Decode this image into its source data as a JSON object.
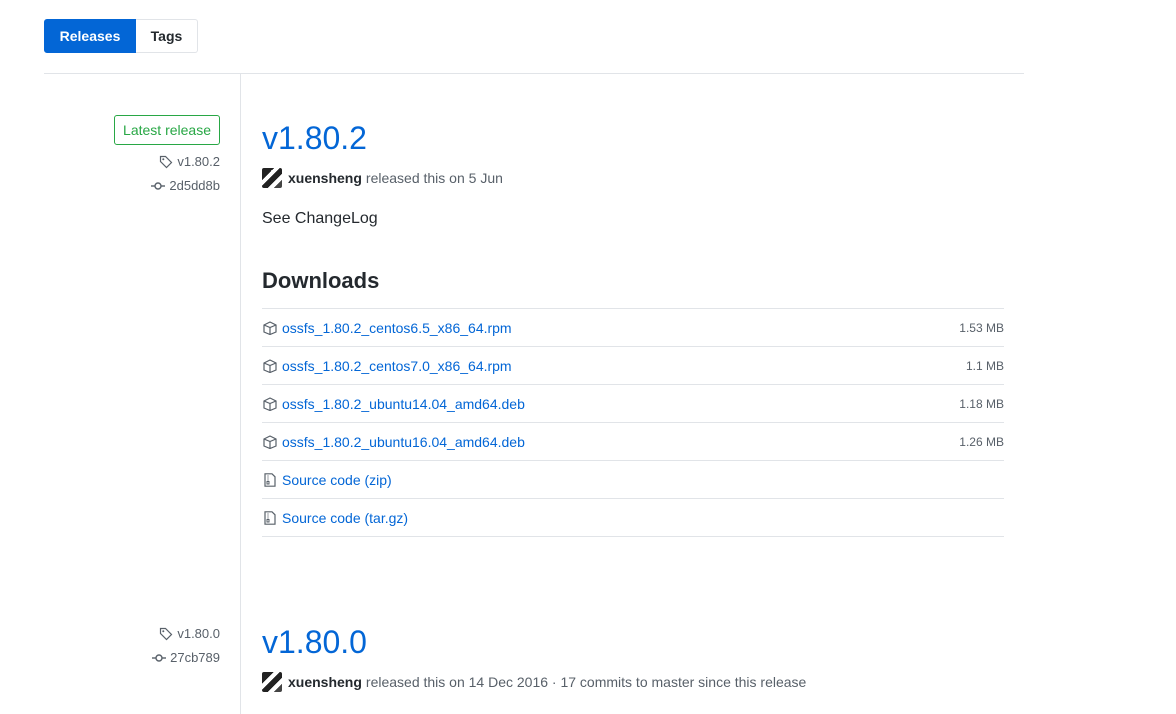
{
  "tabs": [
    {
      "label": "Releases",
      "selected": true
    },
    {
      "label": "Tags",
      "selected": false
    }
  ],
  "colors": {
    "accent": "#0366d6",
    "latest_badge": "#28a745",
    "divider": "#e1e4e8",
    "muted_text": "#586069"
  },
  "releases": [
    {
      "latest_label": "Latest release",
      "tag": "v1.80.2",
      "commit": "2d5dd8b",
      "title": "v1.80.2",
      "author": "xuensheng",
      "byline": "released this on 5 Jun",
      "notes": "See ChangeLog",
      "downloads_heading": "Downloads",
      "assets": [
        {
          "icon": "package-icon",
          "name": "ossfs_1.80.2_centos6.5_x86_64.rpm",
          "size": "1.53 MB"
        },
        {
          "icon": "package-icon",
          "name": "ossfs_1.80.2_centos7.0_x86_64.rpm",
          "size": "1.1 MB"
        },
        {
          "icon": "package-icon",
          "name": "ossfs_1.80.2_ubuntu14.04_amd64.deb",
          "size": "1.18 MB"
        },
        {
          "icon": "package-icon",
          "name": "ossfs_1.80.2_ubuntu16.04_amd64.deb",
          "size": "1.26 MB"
        },
        {
          "icon": "file-zip-icon",
          "name": "Source code (zip)",
          "size": ""
        },
        {
          "icon": "file-zip-icon",
          "name": "Source code (tar.gz)",
          "size": ""
        }
      ]
    },
    {
      "tag": "v1.80.0",
      "commit": "27cb789",
      "title": "v1.80.0",
      "author": "xuensheng",
      "byline": "released this on 14 Dec 2016 · 17 commits to master since this release"
    }
  ]
}
